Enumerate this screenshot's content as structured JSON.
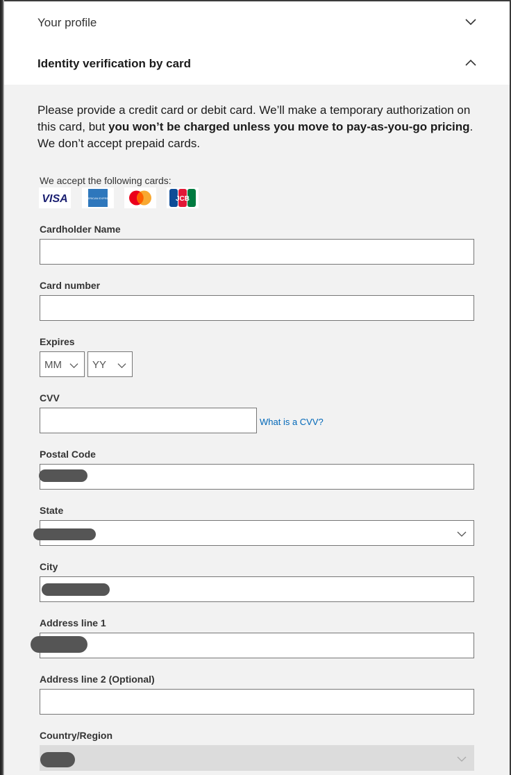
{
  "sections": {
    "profile": {
      "title": "Your profile",
      "expanded": false
    },
    "identity": {
      "title": "Identity verification by card",
      "expanded": true
    }
  },
  "intro": {
    "part1": "Please provide a credit card or debit card. We’ll make a temporary authorization on this card, but ",
    "bold": "you won’t be charged unless you move to pay-as-you-go pricing",
    "part2": ". We don’t accept prepaid cards."
  },
  "accepted_cards": {
    "label": "We accept the following cards:",
    "brands": [
      "VISA",
      "AMEX",
      "Mastercard",
      "JCB"
    ],
    "visa_text": "VISA",
    "amex_text": "AMERICAN EXPRESS",
    "jcb_text": "JCB"
  },
  "form": {
    "cardholder_name": {
      "label": "Cardholder Name",
      "value": ""
    },
    "card_number": {
      "label": "Card number",
      "value": ""
    },
    "expires": {
      "label": "Expires",
      "month_placeholder": "MM",
      "year_placeholder": "YY"
    },
    "cvv": {
      "label": "CVV",
      "value": "",
      "help_link": "What is a CVV?"
    },
    "postal_code": {
      "label": "Postal Code",
      "value_redacted": true
    },
    "state": {
      "label": "State",
      "value_redacted": true
    },
    "city": {
      "label": "City",
      "value_redacted": true
    },
    "address_line1": {
      "label": "Address line 1",
      "value_redacted": true
    },
    "address_line2": {
      "label": "Address line 2 (Optional)",
      "value": ""
    },
    "country_region": {
      "label": "Country/Region",
      "value_redacted": true,
      "disabled": true
    }
  },
  "colors": {
    "link": "#0067b8",
    "panel_bg": "#f2f2f2",
    "header_bg": "#ffffff",
    "input_border": "#767676",
    "redaction": "#555555",
    "mastercard_red": "#eb001b",
    "mastercard_orange": "#f79e1b",
    "visa_blue": "#1a1f71",
    "amex_blue": "#2e77bc"
  }
}
